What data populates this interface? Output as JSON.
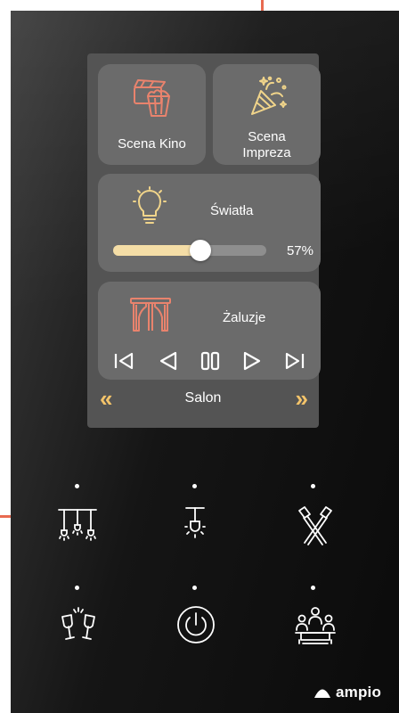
{
  "scenes": {
    "cinema": {
      "label": "Scena Kino",
      "icon": "cinema-icon"
    },
    "party": {
      "label": "Scena\nImpreza",
      "icon": "party-popper-icon"
    }
  },
  "lights": {
    "label": "Światła",
    "icon": "light-bulb-icon",
    "brightness_percent": 57,
    "brightness_text": "57%"
  },
  "blinds": {
    "label": "Żaluzje",
    "icon": "curtains-icon",
    "controls": [
      "step-back-icon",
      "prev-icon",
      "pause-icon",
      "next-icon",
      "step-forward-icon"
    ]
  },
  "room_nav": {
    "prev": "«",
    "room_name": "Salon",
    "next": "»"
  },
  "panel_buttons": [
    {
      "icon": "pendant-lamps-icon"
    },
    {
      "icon": "ceiling-lamp-icon"
    },
    {
      "icon": "spotlights-icon"
    },
    {
      "icon": "toast-glasses-icon"
    },
    {
      "icon": "power-icon"
    },
    {
      "icon": "dining-people-icon"
    }
  ],
  "brand": {
    "name": "ampio"
  },
  "colors": {
    "accent_red": "#e86a50",
    "accent_gold": "#f4c46a",
    "slider_fill": "#f4dda6",
    "tile_bg": "#6b6b6b",
    "screen_bg": "#545454"
  }
}
